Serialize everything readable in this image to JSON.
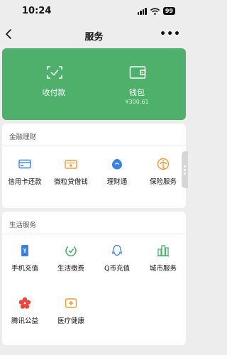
{
  "status": {
    "time": "10:24",
    "battery": "99"
  },
  "nav": {
    "title": "服务",
    "more": "•••"
  },
  "wallet_card": {
    "pay": {
      "label": "收付款",
      "icon": "scan-check-icon"
    },
    "wallet": {
      "label": "钱包",
      "balance": "¥300.61",
      "icon": "wallet-icon"
    }
  },
  "finance": {
    "title": "金融理财",
    "items": [
      {
        "label": "信用卡还款",
        "icon": "credit-card-icon"
      },
      {
        "label": "微粒贷借钱",
        "icon": "loan-icon"
      },
      {
        "label": "理财通",
        "icon": "wealth-icon"
      },
      {
        "label": "保险服务",
        "icon": "umbrella-icon"
      }
    ]
  },
  "life": {
    "title": "生活服务",
    "items": [
      {
        "label": "手机充值",
        "icon": "phone-icon"
      },
      {
        "label": "生活缴费",
        "icon": "utility-icon"
      },
      {
        "label": "Q币充值",
        "icon": "qq-icon"
      },
      {
        "label": "城市服务",
        "icon": "city-icon"
      },
      {
        "label": "腾讯公益",
        "icon": "charity-icon"
      },
      {
        "label": "医疗健康",
        "icon": "medical-icon"
      }
    ]
  },
  "colors": {
    "green": "#4fb06c",
    "blue": "#3b82e0",
    "orange": "#f29a38",
    "red": "#e8453c"
  }
}
